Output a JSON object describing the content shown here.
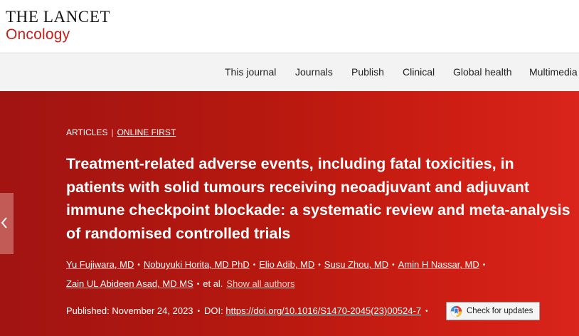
{
  "brand": {
    "name": "THE LANCET",
    "journal": "Oncology",
    "accent_color": "#c7201c"
  },
  "nav": {
    "items": [
      "This journal",
      "Journals",
      "Publish",
      "Clinical",
      "Global health",
      "Multimedia"
    ]
  },
  "article": {
    "type_label": "ARTICLES",
    "separator": "|",
    "status_label": "ONLINE FIRST",
    "title": "Treatment-related adverse events, including fatal toxicities, in patients with solid tumours receiving neoadjuvant and adjuvant immune checkpoint blockade: a systematic review and meta-analysis of randomised controlled trials",
    "authors": [
      "Yu Fujiwara, MD",
      "Nobuyuki Horita, MD PhD",
      "Elio Adib, MD",
      "Susu Zhou, MD",
      "Amin H Nassar, MD",
      "Zain UL Abideen Asad, MD MS"
    ],
    "et_al": "et al.",
    "show_all_label": "Show all authors",
    "author_separator": "•",
    "published_label": "Published:",
    "published_date": "November 24, 2023",
    "doi_label": "DOI:",
    "doi_url": "https://doi.org/10.1016/S1470-2045(23)00524-7",
    "check_updates_label": "Check for updates"
  },
  "icons": {
    "side_tab": "chevron-left-icon",
    "check_updates": "crossmark-icon"
  },
  "colors": {
    "hero_start": "#a11412",
    "hero_end": "#d9251b",
    "nav_bg": "#f3f3f3"
  }
}
